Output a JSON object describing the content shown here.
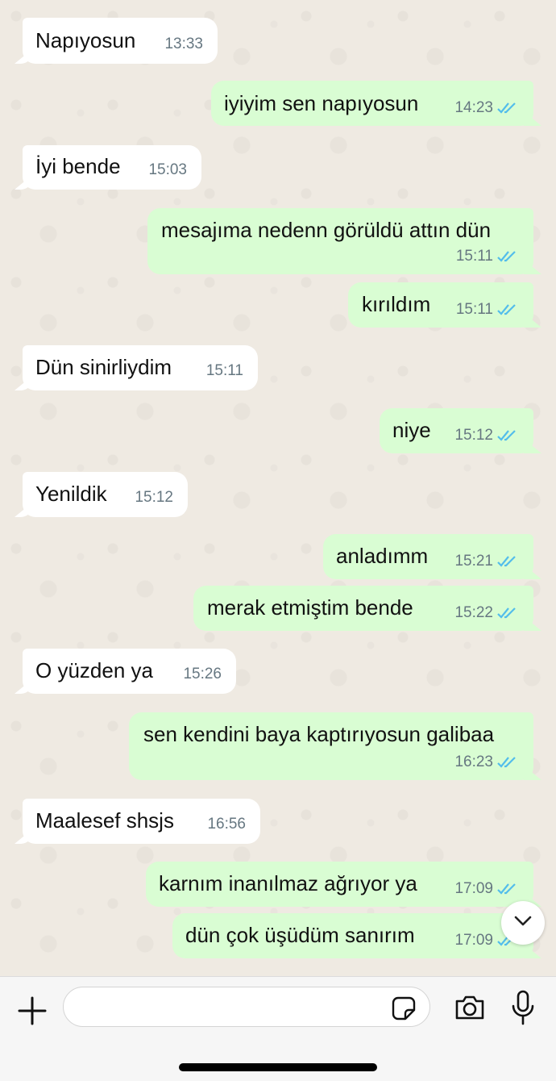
{
  "messages": [
    {
      "dir": "in",
      "text": "Napıyosun",
      "time": "13:33"
    },
    {
      "dir": "out",
      "text": "iyiyim sen napıyosun",
      "time": "14:23",
      "read": true
    },
    {
      "dir": "in",
      "text": "İyi bende",
      "time": "15:03"
    },
    {
      "dir": "out",
      "text": "mesajıma nedenn görüldü attın dün",
      "time": "15:11",
      "read": true
    },
    {
      "dir": "out",
      "text": "kırıldım",
      "time": "15:11",
      "read": true
    },
    {
      "dir": "in",
      "text": "Dün sinirliydim",
      "time": "15:11"
    },
    {
      "dir": "out",
      "text": "niye",
      "time": "15:12",
      "read": true
    },
    {
      "dir": "in",
      "text": "Yenildik",
      "time": "15:12"
    },
    {
      "dir": "out",
      "text": "anladımm",
      "time": "15:21",
      "read": true
    },
    {
      "dir": "out",
      "text": "merak etmiştim bende",
      "time": "15:22",
      "read": true
    },
    {
      "dir": "in",
      "text": "O yüzden ya",
      "time": "15:26"
    },
    {
      "dir": "out",
      "text": "sen kendini baya kaptırıyosun galibaa",
      "time": "16:23",
      "read": true
    },
    {
      "dir": "in",
      "text": "Maalesef shsjs",
      "time": "16:56"
    },
    {
      "dir": "out",
      "text": "karnım inanılmaz ağrıyor ya",
      "time": "17:09",
      "read": true
    },
    {
      "dir": "out",
      "text": "dün çok üşüdüm sanırım",
      "time": "17:09",
      "read": true
    }
  ],
  "composer": {
    "placeholder": "",
    "icons": [
      "plus-icon",
      "sticker-icon",
      "camera-icon",
      "microphone-icon"
    ]
  },
  "scroll_button_icon": "chevron-down-icon",
  "colors": {
    "incoming_bubble": "#ffffff",
    "outgoing_bubble": "#d9fdd3",
    "read_ticks": "#53bdeb",
    "timestamp": "#667781",
    "chat_background": "#efeae2"
  }
}
